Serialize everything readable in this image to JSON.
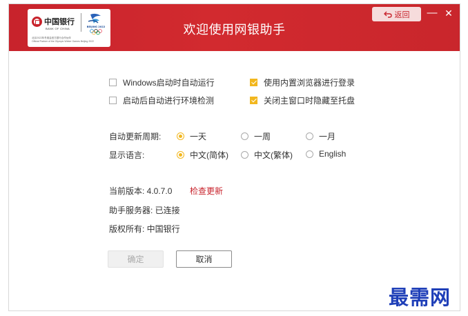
{
  "header": {
    "title": "欢迎使用网银助手",
    "back_label": "返回",
    "minimize_symbol": "—",
    "close_symbol": "✕",
    "logo": {
      "bank_cn": "中国银行",
      "bank_en": "BANK OF CHINA",
      "olympic_text": "BEIJING 2022",
      "tagline_cn": "北京2022年冬奥会官方银行合作伙伴",
      "tagline_en": "Official Partner of the Olympic Winter Games Beijing 2022"
    }
  },
  "options": {
    "checkboxes": [
      {
        "label": "Windows启动时自动运行",
        "checked": false
      },
      {
        "label": "使用内置浏览器进行登录",
        "checked": true
      },
      {
        "label": "启动后自动进行环境检测",
        "checked": false
      },
      {
        "label": "关闭主窗口时隐藏至托盘",
        "checked": true
      }
    ]
  },
  "update_period": {
    "label": "自动更新周期:",
    "options": [
      {
        "label": "一天",
        "selected": true
      },
      {
        "label": "一周",
        "selected": false
      },
      {
        "label": "一月",
        "selected": false
      }
    ]
  },
  "language": {
    "label": "显示语言:",
    "options": [
      {
        "label": "中文(简体)",
        "selected": true
      },
      {
        "label": "中文(繁体)",
        "selected": false
      },
      {
        "label": "English",
        "selected": false
      }
    ]
  },
  "info": {
    "version": "当前版本: 4.0.7.0",
    "check_update": "检查更新",
    "server": "助手服务器: 已连接",
    "copyright": "版权所有: 中国银行"
  },
  "buttons": {
    "ok": "确定",
    "cancel": "取消"
  },
  "watermark": "最需网",
  "colors": {
    "brand_red": "#c8232c",
    "accent_yellow": "#f2b71e",
    "watermark_blue": "#1f3fb8"
  }
}
